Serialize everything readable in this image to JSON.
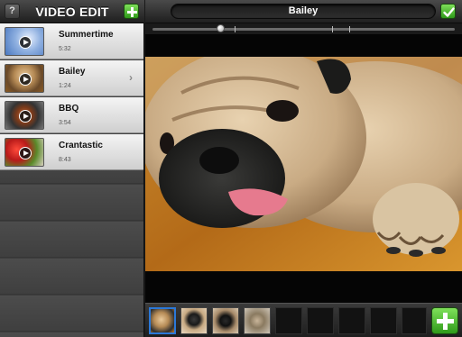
{
  "sidebar": {
    "help_label": "?",
    "title": "VIDEO EDIT",
    "items": [
      {
        "name": "Summertime",
        "duration": "5:32",
        "thumb": "snow-thumbnail"
      },
      {
        "name": "Bailey",
        "duration": "1:24",
        "thumb": "pug-thumbnail"
      },
      {
        "name": "BBQ",
        "duration": "3:54",
        "thumb": "grill-thumbnail"
      },
      {
        "name": "Crantastic",
        "duration": "8:43",
        "thumb": "cranberry-thumbnail"
      }
    ]
  },
  "topbar": {
    "title": "Bailey"
  },
  "scrubber": {
    "position": 0.23
  },
  "timeline": {
    "clip_count": 4,
    "selected_index": 0
  },
  "icons": {
    "add": "plus-icon",
    "confirm": "checkmark-icon",
    "help": "help-icon",
    "play": "play-icon",
    "chevron": "chevron-right-icon"
  },
  "colors": {
    "accent_green": "#3fb524",
    "selection_blue": "#2b78d8"
  }
}
